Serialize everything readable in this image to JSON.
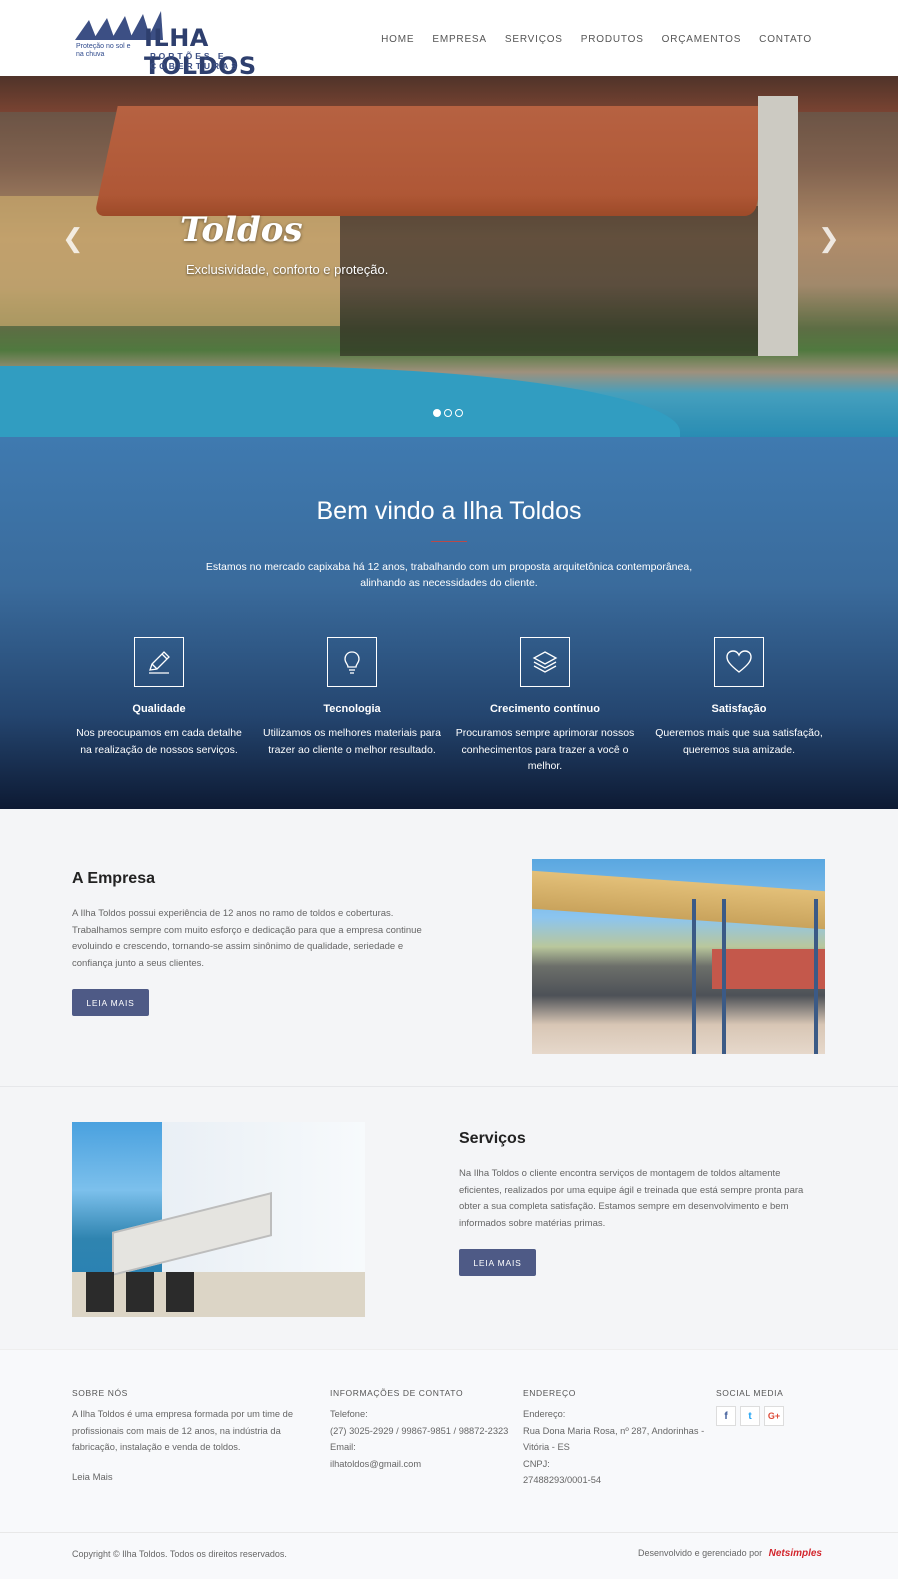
{
  "header": {
    "logo_slogan": "Proteção no sol e na chuva",
    "logo_title": "ILHA TOLDOS",
    "logo_subtitle": "PORTÕES E COBERTURAS",
    "nav": [
      "HOME",
      "EMPRESA",
      "SERVIÇOS",
      "PRODUTOS",
      "ORÇAMENTOS",
      "CONTATO"
    ]
  },
  "hero": {
    "title": "Toldos",
    "subtitle": "Exclusividade, conforto e proteção.",
    "prev_icon": "chevron-left-icon",
    "next_icon": "chevron-right-icon",
    "active_slide": 1,
    "slide_count": 3
  },
  "welcome": {
    "title": "Bem vindo a Ilha Toldos",
    "text": "Estamos no mercado capixaba há 12 anos, trabalhando com um proposta arquitetônica contemporânea, alinhando as necessidades do cliente.",
    "features": [
      {
        "icon": "pencil-icon",
        "title": "Qualidade",
        "text": "Nos preocupamos em cada detalhe na realização de nossos serviços."
      },
      {
        "icon": "lightbulb-icon",
        "title": "Tecnologia",
        "text": "Utilizamos os melhores materiais para trazer ao cliente o melhor resultado."
      },
      {
        "icon": "layers-icon",
        "title": "Crecimento contínuo",
        "text": "Procuramos sempre aprimorar nossos conhecimentos para trazer a você o melhor."
      },
      {
        "icon": "heart-icon",
        "title": "Satisfação",
        "text": "Queremos mais que sua satisfação, queremos sua amizade."
      }
    ]
  },
  "empresa": {
    "title": "A Empresa",
    "text": "A Ilha Toldos possui experiência de 12 anos no ramo de toldos e coberturas. Trabalhamos sempre com muito esforço e dedicação para que a empresa continue evoluindo e crescendo, tornando-se assim sinônimo de qualidade, seriedade e confiança junto a seus clientes.",
    "button": "LEIA MAIS"
  },
  "servicos": {
    "title": "Serviços",
    "text": "Na Ilha Toldos o cliente encontra serviços de montagem de toldos altamente eficientes, realizados por uma equipe ágil e treinada que está sempre pronta para obter a sua completa satisfação. Estamos sempre em desenvolvimento e bem informados sobre matérias primas.",
    "button": "LEIA MAIS"
  },
  "footer": {
    "about_head": "SOBRE NÓS",
    "about_text": "A Ilha Toldos é uma empresa formada por um time de profissionais com mais de 12 anos, na indústria da fabricação, instalação e venda de toldos.",
    "about_link": "Leia Mais",
    "contact_head": "INFORMAÇÕES DE CONTATO",
    "phone_label": "Telefone:",
    "phone": "(27) 3025-2929 / 99867-9851 / 98872-2323",
    "email_label": "Email:",
    "email": "ilhatoldos@gmail.com",
    "address_head": "ENDEREÇO",
    "address_label": "Endereço:",
    "address": "Rua Dona Maria Rosa, nº 287, Andorinhas - Vitória - ES",
    "cnpj_label": "CNPJ:",
    "cnpj": "27488293/0001-54",
    "social_head": "SOCIAL MEDIA",
    "social": [
      {
        "icon": "facebook-icon",
        "glyph": "f",
        "color": "#3b5998"
      },
      {
        "icon": "twitter-icon",
        "glyph": "t",
        "color": "#1da1f2"
      },
      {
        "icon": "google-plus-icon",
        "glyph": "G+",
        "color": "#dd4b39"
      }
    ],
    "copyright": "Copyright © Ilha Toldos. Todos os direitos reservados.",
    "developed": "Desenvolvido e gerenciado por",
    "developer": "Netsimples"
  }
}
